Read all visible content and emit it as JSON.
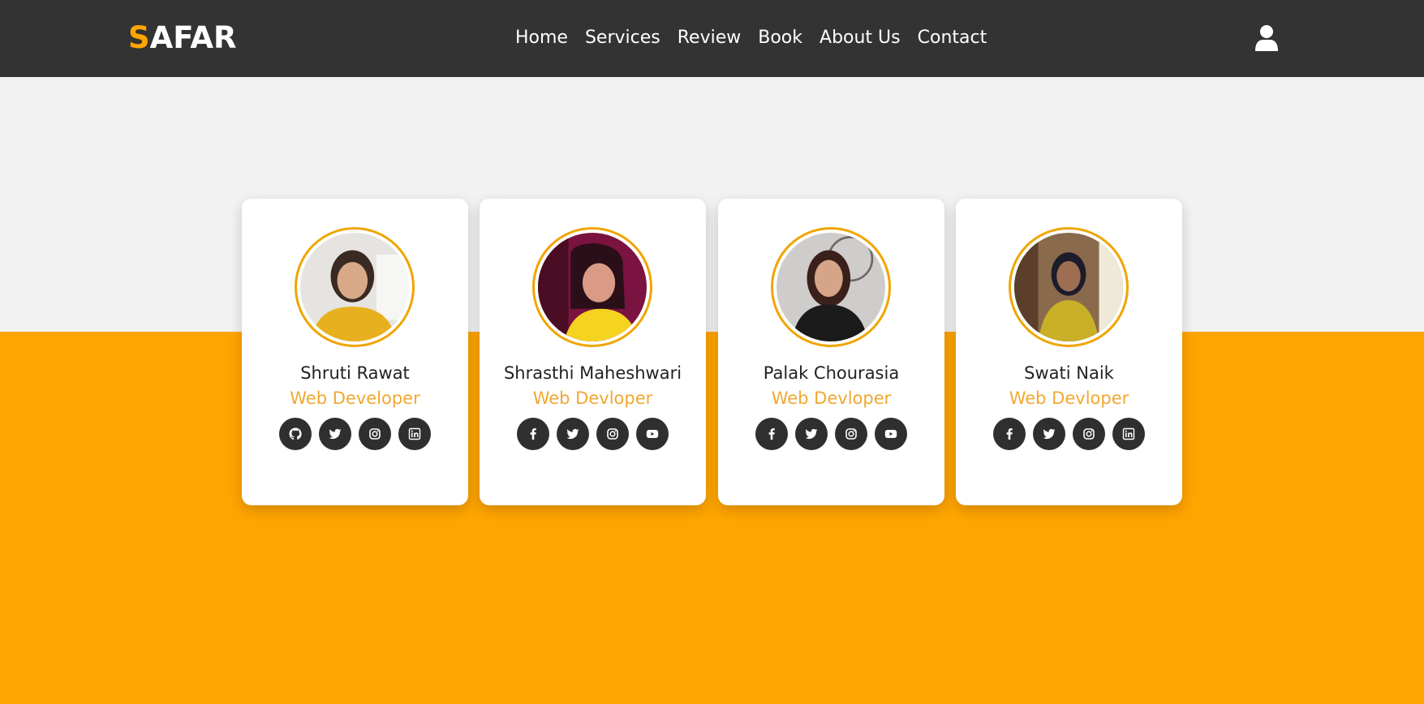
{
  "brand": {
    "logo_first": "S",
    "logo_rest": "AFAR"
  },
  "nav": {
    "links": [
      {
        "label": "Home"
      },
      {
        "label": "Services"
      },
      {
        "label": "Review"
      },
      {
        "label": "Book"
      },
      {
        "label": "About Us"
      },
      {
        "label": "Contact"
      }
    ],
    "user_icon": "user-icon"
  },
  "colors": {
    "nav_bg": "#333333",
    "accent": "#ffa500",
    "role_text": "#f0a830",
    "card_bg": "#ffffff",
    "social_bg": "#2f2f2f"
  },
  "team": [
    {
      "name": "Shruti Rawat",
      "role": "Web Developer",
      "socials": [
        "github-icon",
        "twitter-icon",
        "instagram-icon",
        "linkedin-icon"
      ]
    },
    {
      "name": "Shrasthi Maheshwari",
      "role": "Web Devloper",
      "socials": [
        "facebook-icon",
        "twitter-icon",
        "instagram-icon",
        "youtube-icon"
      ]
    },
    {
      "name": "Palak Chourasia",
      "role": "Web Devloper",
      "socials": [
        "facebook-icon",
        "twitter-icon",
        "instagram-icon",
        "youtube-icon"
      ]
    },
    {
      "name": "Swati Naik",
      "role": "Web Devloper",
      "socials": [
        "facebook-icon",
        "twitter-icon",
        "instagram-icon",
        "linkedin-icon"
      ]
    }
  ]
}
